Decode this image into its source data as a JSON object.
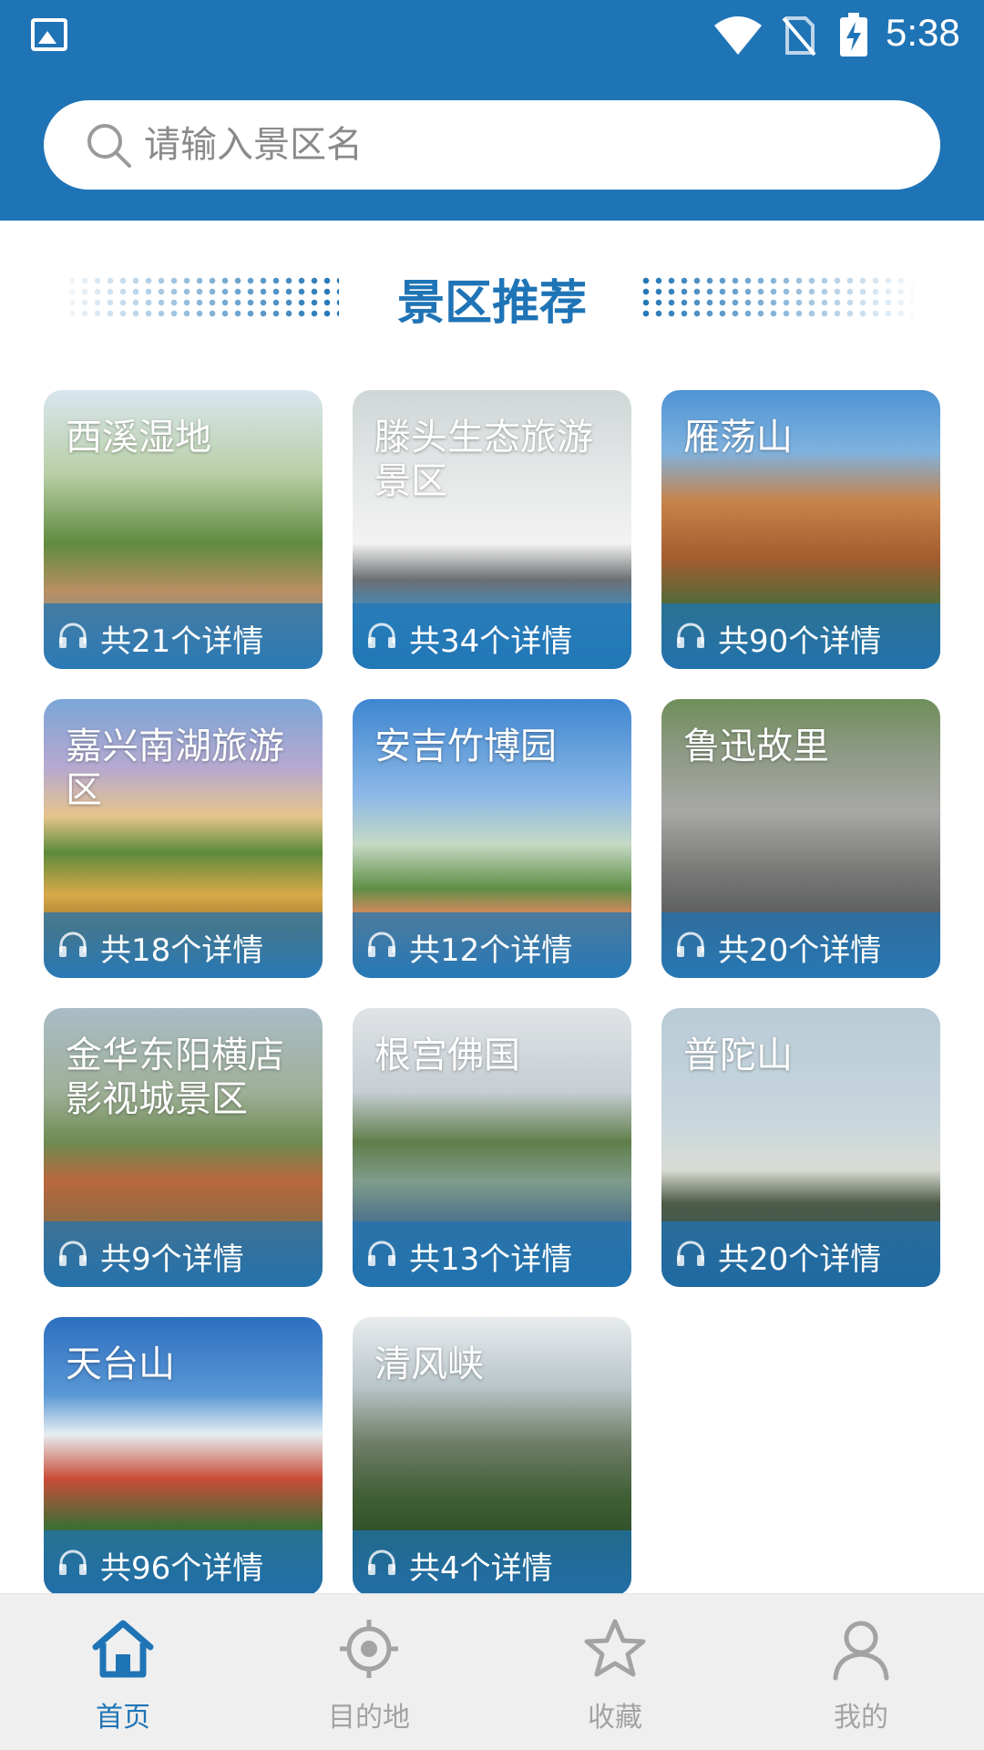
{
  "status_bar": {
    "time": "5:38"
  },
  "search": {
    "placeholder": "请输入景区名"
  },
  "section": {
    "title": "景区推荐"
  },
  "cards": [
    {
      "name": "西溪湿地",
      "count": "共21个详情"
    },
    {
      "name": "滕头生态旅游景区",
      "count": "共34个详情"
    },
    {
      "name": "雁荡山",
      "count": "共90个详情"
    },
    {
      "name": "嘉兴南湖旅游区",
      "count": "共18个详情"
    },
    {
      "name": "安吉竹博园",
      "count": "共12个详情"
    },
    {
      "name": "鲁迅故里",
      "count": "共20个详情"
    },
    {
      "name": "金华东阳横店影视城景区",
      "count": "共9个详情"
    },
    {
      "name": "根宫佛国",
      "count": "共13个详情"
    },
    {
      "name": "普陀山",
      "count": "共20个详情"
    },
    {
      "name": "天台山",
      "count": "共96个详情"
    },
    {
      "name": "清风峡",
      "count": "共4个详情"
    }
  ],
  "nav": [
    {
      "label": "首页",
      "icon": "home-icon",
      "active": true
    },
    {
      "label": "目的地",
      "icon": "location-icon",
      "active": false
    },
    {
      "label": "收藏",
      "icon": "star-icon",
      "active": false
    },
    {
      "label": "我的",
      "icon": "user-icon",
      "active": false
    }
  ],
  "colors": {
    "primary": "#1f74b6",
    "nav_inactive": "#a3a3a3",
    "nav_bg": "#efefef"
  }
}
